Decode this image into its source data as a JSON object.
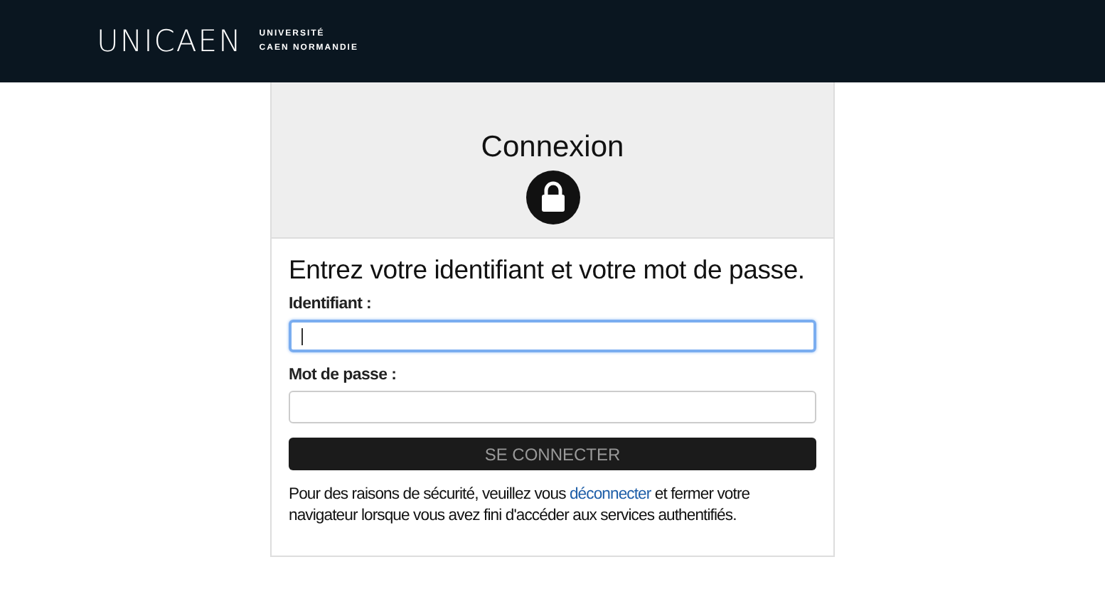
{
  "header": {
    "logo": "UNICAEN",
    "logo_line_1": "UNIVERSITÉ",
    "logo_line_2": "CAEN NORMANDIE"
  },
  "login": {
    "title": "Connexion",
    "heading": "Entrez votre identifiant et votre mot de passe.",
    "fields": [
      {
        "label": "Identifiant :",
        "focused": true
      },
      {
        "label": "Mot de passe :",
        "focused": false
      }
    ],
    "submit": "SE CONNECTER",
    "notice": {
      "before": "Pour des raisons de sécurité, veuillez vous ",
      "link": "déconnecter",
      "after": " et fermer votre navigateur lorsque vous avez fini d'accéder aux services authentifiés."
    }
  }
}
